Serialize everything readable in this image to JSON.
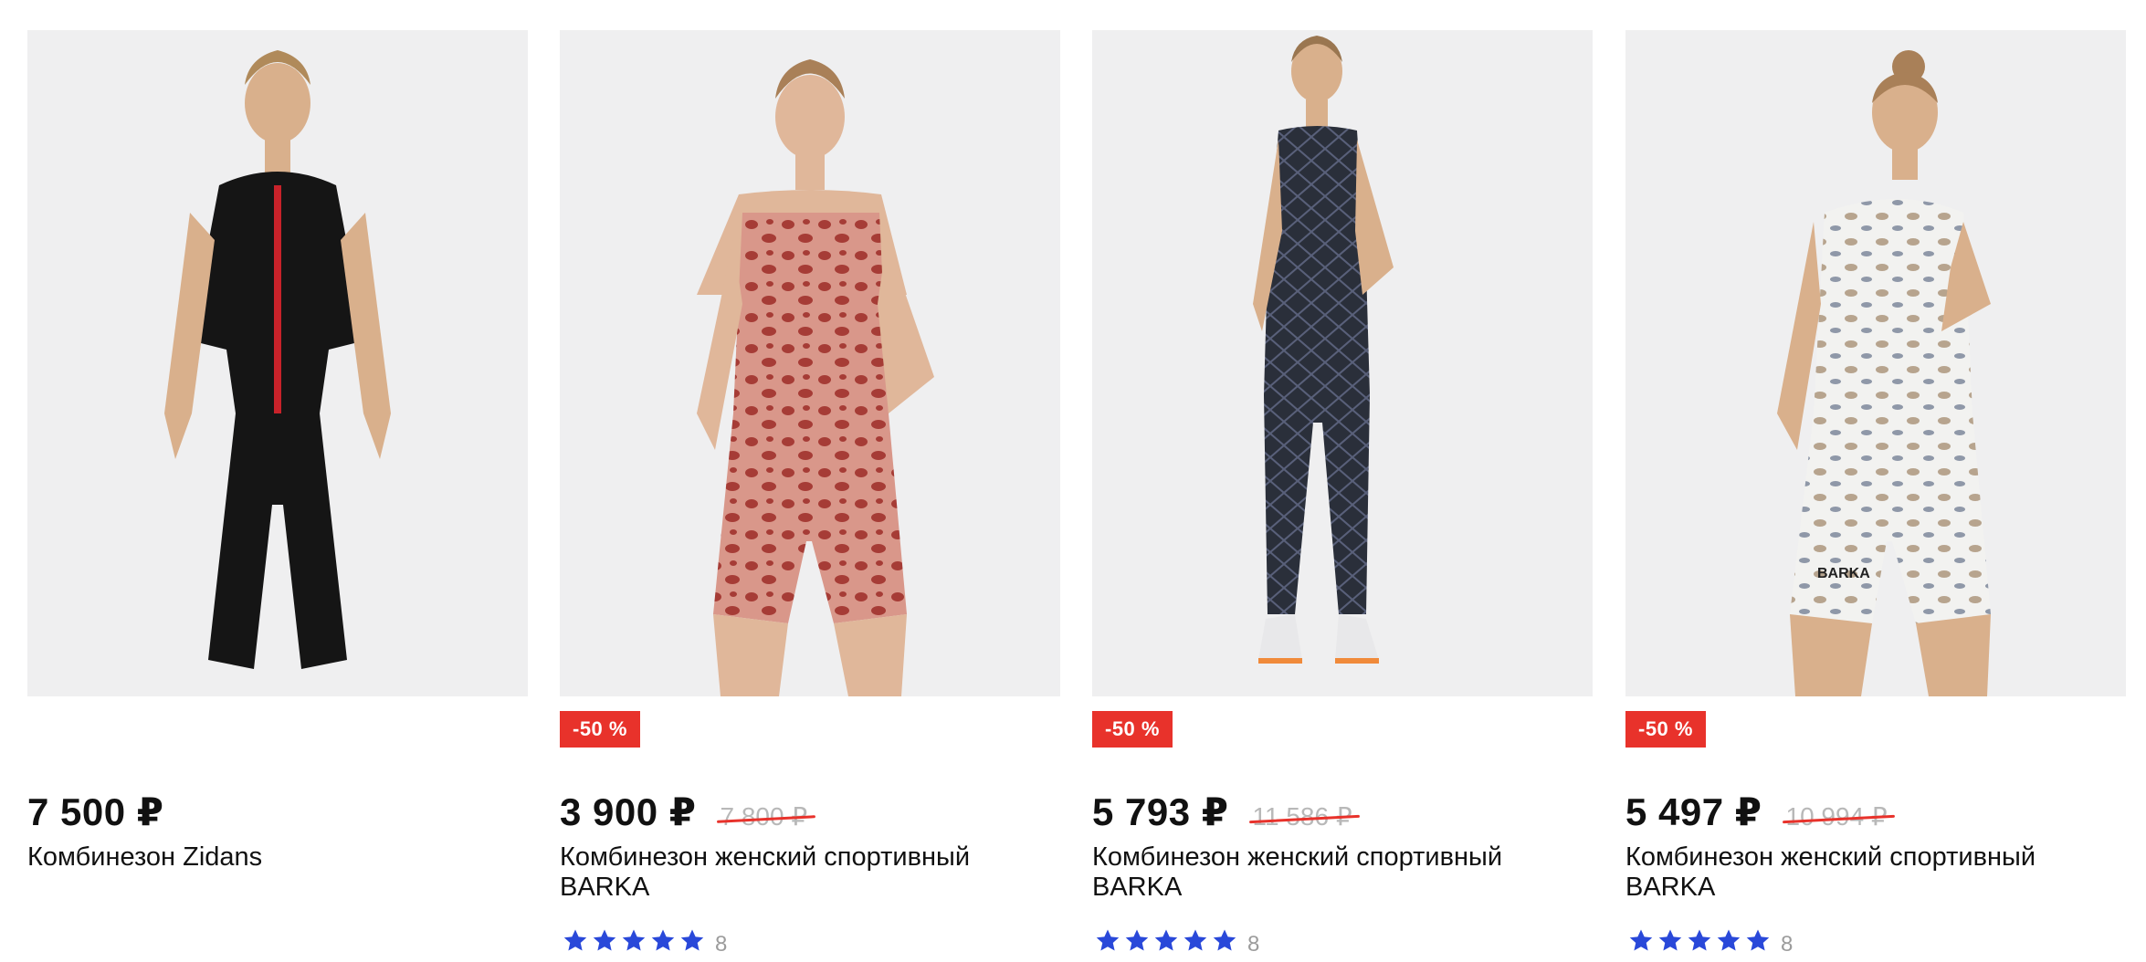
{
  "colors": {
    "sale_badge": "#e8322b",
    "star": "#2948d9",
    "card_bg": "#efeff0"
  },
  "products": [
    {
      "title": "Комбинезон Zidans",
      "price": "7 500 ₽",
      "old_price": "",
      "discount": "",
      "rating_count": "",
      "stars": 0,
      "image_icon": "black-bodysuit-red-zipper-photo"
    },
    {
      "title": "Комбинезон женский спортивный BARKA",
      "price": "3 900 ₽",
      "old_price": "7 800 ₽",
      "discount": "-50 %",
      "rating_count": "8",
      "stars": 5,
      "image_icon": "leopard-bodysuit-photo"
    },
    {
      "title": "Комбинезон женский спортивный BARKA",
      "price": "5 793 ₽",
      "old_price": "11 586 ₽",
      "discount": "-50 %",
      "rating_count": "8",
      "stars": 5,
      "image_icon": "snake-print-jumpsuit-photo"
    },
    {
      "title": "Комбинезон женский спортивный BARKA",
      "price": "5 497 ₽",
      "old_price": "10 994 ₽",
      "discount": "-50 %",
      "rating_count": "8",
      "stars": 5,
      "image_icon": "white-snake-bodysuit-photo"
    }
  ]
}
